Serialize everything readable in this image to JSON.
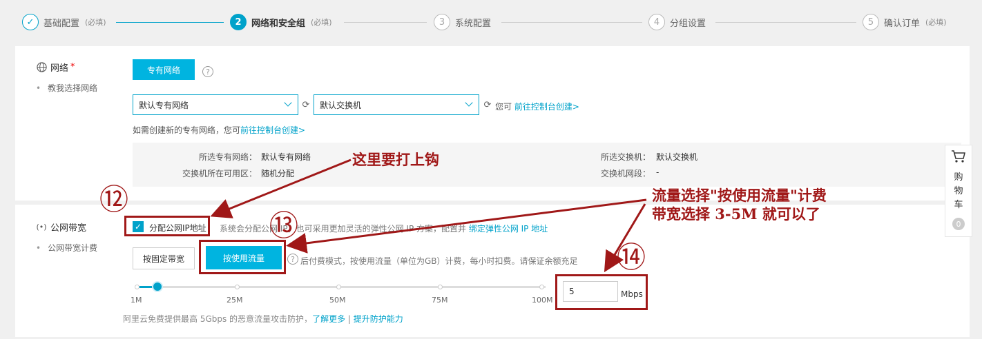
{
  "steps": [
    {
      "num": "✓",
      "label": "基础配置",
      "required": "(必填)",
      "state": "done"
    },
    {
      "num": "2",
      "label": "网络和安全组",
      "required": "(必填)",
      "state": "active"
    },
    {
      "num": "3",
      "label": "系统配置",
      "required": "",
      "state": "todo"
    },
    {
      "num": "4",
      "label": "分组设置",
      "required": "",
      "state": "todo"
    },
    {
      "num": "5",
      "label": "确认订单",
      "required": "(必填)",
      "state": "todo"
    }
  ],
  "network": {
    "title": "网络",
    "required_mark": "*",
    "help_link": "教我选择网络",
    "tab_label": "专有网络",
    "help_icon": "?",
    "vpc_select": "默认专有网络",
    "switch_select": "默认交换机",
    "create_prefix": "您可",
    "create_link": "前往控制台创建>",
    "hint_prefix": "如需创建新的专有网络，您可",
    "hint_link": "前往控制台创建>",
    "info": {
      "vpc_label": "所选专有网络：",
      "vpc_value": "默认专有网络",
      "zone_label": "交换机所在可用区：",
      "zone_value": "随机分配",
      "switch_label": "所选交换机：",
      "switch_value": "默认交换机",
      "cidr_label": "交换机网段：",
      "cidr_value": "-"
    }
  },
  "bandwidth": {
    "title": "公网带宽",
    "help_link": "公网带宽计费",
    "assign_ip_label": "分配公网IP地址",
    "assign_ip_checked": true,
    "assign_ip_desc": "系统会分配公网 IP，也可采用更加灵活的弹性公网 IP 方案，配置并",
    "assign_ip_link": "绑定弹性公网 IP 地址",
    "fixed_btn": "按固定带宽",
    "traffic_btn": "按使用流量",
    "billing_desc": "后付费模式，按使用流量（单位为GB）计费，每小时扣费。请保证余额充足",
    "slider_labels": [
      "1M",
      "25M",
      "50M",
      "75M",
      "100M"
    ],
    "slider_value_fraction": 0.05,
    "input_value": "5",
    "unit": "Mbps",
    "ddos_text": "阿里云免费提供最高 5Gbps 的恶意流量攻击防护，",
    "ddos_link1": "了解更多",
    "ddos_sep": " | ",
    "ddos_link2": "提升防护能力"
  },
  "annotations": {
    "note1": "这里要打上钩",
    "note2_line1": "流量选择\"按使用流量\"计费",
    "note2_line2": "带宽选择 3-5M 就可以了",
    "num12": "⑫",
    "num13": "⑬",
    "num14": "⑭",
    "color": "#a01818"
  },
  "cart": {
    "icon": "cart-icon",
    "chars": [
      "购",
      "物",
      "车"
    ],
    "count": "0"
  },
  "colors": {
    "accent": "#00a2ca",
    "button": "#00b4e0",
    "annotation": "#a01818"
  }
}
